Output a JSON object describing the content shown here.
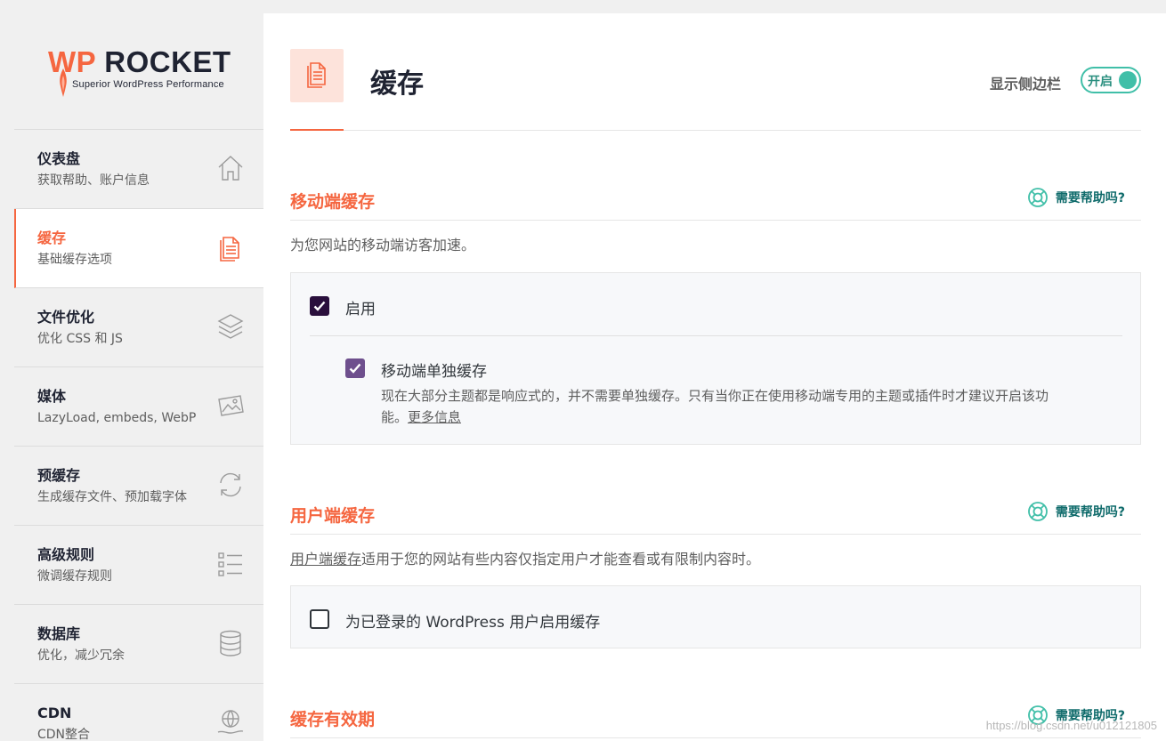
{
  "brand": {
    "wp": "WP",
    "rocket": "ROCKET",
    "tagline": "Superior WordPress Performance"
  },
  "sidebar": {
    "items": [
      {
        "title": "仪表盘",
        "subtitle": "获取帮助、账户信息",
        "icon": "home-icon"
      },
      {
        "title": "缓存",
        "subtitle": "基础缓存选项",
        "icon": "document-icon",
        "active": true
      },
      {
        "title": "文件优化",
        "subtitle": "优化 CSS 和 JS",
        "icon": "layers-icon"
      },
      {
        "title": "媒体",
        "subtitle": "LazyLoad, embeds, WebP",
        "icon": "image-icon"
      },
      {
        "title": "预缓存",
        "subtitle": "生成缓存文件、预加载字体",
        "icon": "refresh-icon"
      },
      {
        "title": "高级规则",
        "subtitle": "微调缓存规则",
        "icon": "list-icon"
      },
      {
        "title": "数据库",
        "subtitle": "优化，减少冗余",
        "icon": "database-icon"
      },
      {
        "title": "CDN",
        "subtitle": "CDN整合",
        "icon": "globe-hand-icon"
      }
    ]
  },
  "header": {
    "title": "缓存",
    "sidebar_toggle_label": "显示侧边栏",
    "toggle_state": "开启"
  },
  "sections": {
    "mobile": {
      "title": "移动端缓存",
      "help": "需要帮助吗?",
      "description": "为您网站的移动端访客加速。",
      "enable_label": "启用",
      "enable_checked": true,
      "separate_label": "移动端单独缓存",
      "separate_checked": true,
      "separate_desc_line1": "现在大部分主题都是响应式的，并不需要单独缓存。只有当你正在使用移动端专用的主题或插件时才建议开启该功",
      "separate_desc_line2": "能。",
      "more_info": "更多信息"
    },
    "user": {
      "title": "用户端缓存",
      "help": "需要帮助吗?",
      "description_link": "用户端缓存",
      "description_rest": "适用于您的网站有些内容仅指定用户才能查看或有限制内容时。",
      "checkbox_label": "为已登录的 WordPress 用户启用缓存",
      "checkbox_checked": false
    },
    "lifespan": {
      "title": "缓存有效期",
      "help": "需要帮助吗?"
    }
  },
  "watermark": "https://blog.csdn.net/u012121805",
  "colors": {
    "accent": "#f56640",
    "teal": "#40bfa8",
    "dark_check": "#2a0f3c",
    "purple_check": "#6e4f8d"
  }
}
